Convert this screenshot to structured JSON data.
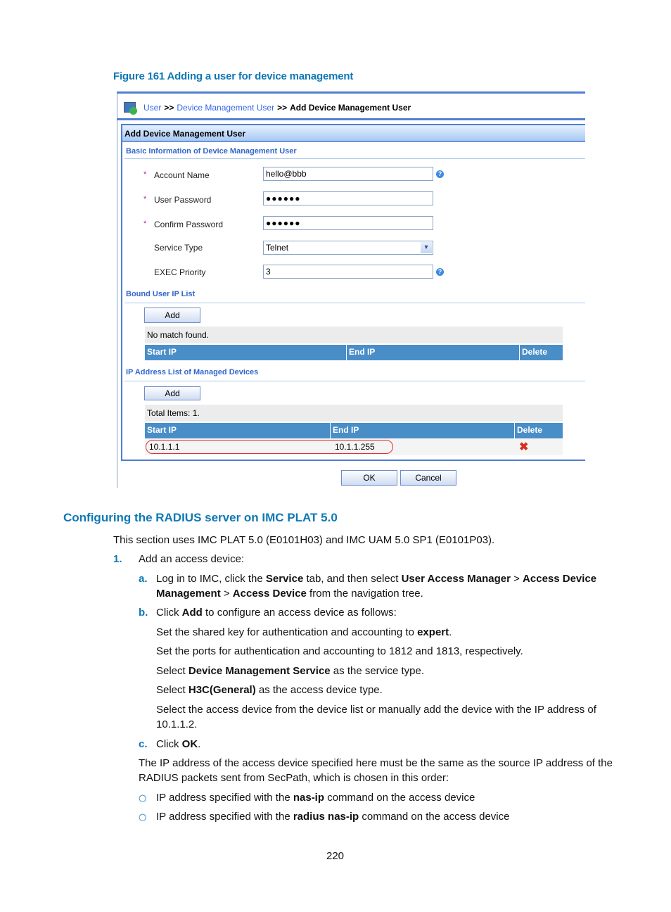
{
  "figure_caption": "Figure 161 Adding a user for device management",
  "ui": {
    "breadcrumb": {
      "icon": "user-device-icon",
      "items": [
        "User",
        "Device Management User",
        "Add Device Management User"
      ],
      "separator": ">>"
    },
    "panel_title": "Add Device Management User",
    "basic_section_title": "Basic Information of Device Management User",
    "fields": [
      {
        "label": "Account Name",
        "required": "*",
        "value": "hello@bbb",
        "help": "?"
      },
      {
        "label": "User Password",
        "required": "*",
        "value": "●●●●●●"
      },
      {
        "label": "Confirm Password",
        "required": "*",
        "value": "●●●●●●"
      },
      {
        "label": "Service Type",
        "value": "Telnet",
        "dropdown_icon": "▾"
      },
      {
        "label": "EXEC Priority",
        "value": "3",
        "help": "?"
      }
    ],
    "bound_section": {
      "title": "Bound User IP List",
      "add_label": "Add",
      "info": "No match found.",
      "columns": [
        "Start IP",
        "End IP",
        "Delete"
      ]
    },
    "managed_section": {
      "title": "IP Address List of Managed Devices",
      "add_label": "Add",
      "info": "Total Items: 1.",
      "columns": [
        "Start IP",
        "End IP",
        "Delete"
      ],
      "rows": [
        {
          "start": "10.1.1.1",
          "end": "10.1.1.255",
          "delete_icon": "✖"
        }
      ]
    },
    "ok_label": "OK",
    "cancel_label": "Cancel"
  },
  "section_heading": "Configuring the RADIUS server on IMC PLAT 5.0",
  "intro": "This section uses IMC PLAT 5.0 (E0101H03) and IMC UAM 5.0 SP1 (E0101P03).",
  "step1": {
    "num": "1.",
    "text": "Add an access device:"
  },
  "step_a": {
    "num": "a.",
    "t1": "Log in to IMC, click the ",
    "b1": "Service",
    "t2": " tab, and then select ",
    "b2": "User Access Manager",
    "t3": " > ",
    "b3": "Access Device",
    "b4": "Management",
    "t4": " > ",
    "b5": "Access Device",
    "t5": " from the navigation tree."
  },
  "step_b": {
    "num": "b.",
    "t1": "Click ",
    "b1": "Add",
    "t2": " to configure an access device as follows:",
    "l1a": "Set the shared key for authentication and accounting to ",
    "l1b": "expert",
    "l1c": ".",
    "l2": "Set the ports for authentication and accounting to 1812 and 1813, respectively.",
    "l3a": "Select ",
    "l3b": "Device Management Service",
    "l3c": " as the service type.",
    "l4a": "Select ",
    "l4b": "H3C(General)",
    "l4c": " as the access device type.",
    "l5": "Select the access device from the device list or manually add the device with the IP address of",
    "l5b": "10.1.1.2."
  },
  "step_c": {
    "num": "c.",
    "t1": "Click ",
    "b1": "OK",
    "t2": "."
  },
  "note1": "The IP address of the access device specified here must be the same as the source IP address of the",
  "note2": "RADIUS packets sent from SecPath, which is chosen in this order:",
  "bullets": [
    {
      "mark": "○",
      "t1": "IP address specified with the ",
      "b1": "nas-ip",
      "t2": " command on the access device"
    },
    {
      "mark": "○",
      "t1": "IP address specified with the ",
      "b1": "radius nas-ip",
      "t2": " command on the access device"
    }
  ],
  "page_number": "220"
}
